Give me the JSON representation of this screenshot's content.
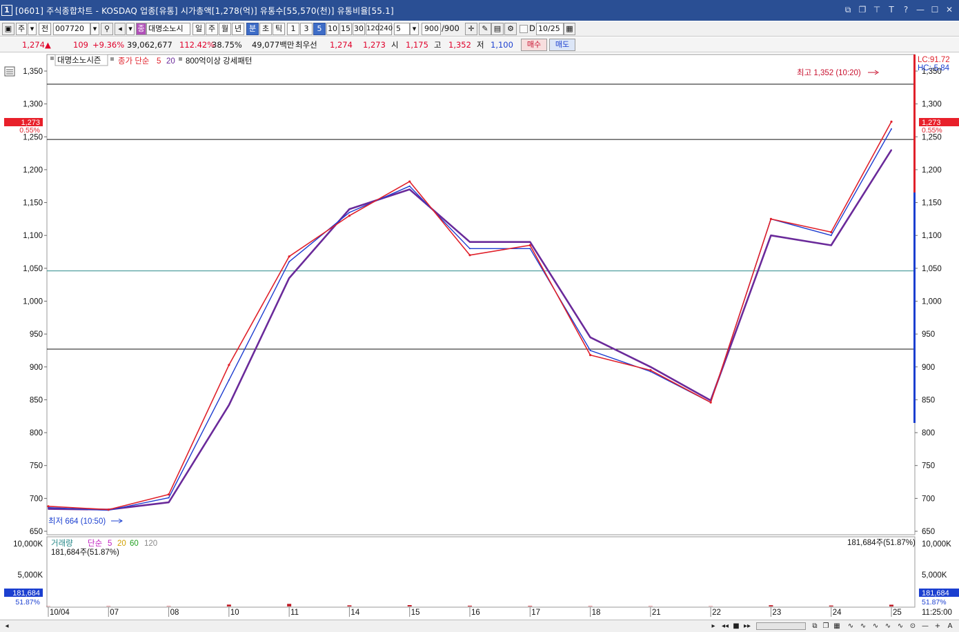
{
  "window": {
    "number": "1",
    "title": "[0601] 주식종합차트 - KOSDAQ 업종[유통] 시가총액[1,278(억)] 유통수[55,570(천)] 유통비율[55.1]",
    "controls": [
      "link-icon",
      "restore-icon",
      "pin-icon",
      "font-icon",
      "help-icon",
      "minimize-icon",
      "maximize-icon",
      "close-icon"
    ]
  },
  "toolbar": {
    "code_type": "주",
    "prev_label": "전",
    "code": "007720",
    "stock_badge": "종",
    "stock_name": "대명소노시",
    "period_tabs": [
      "일",
      "주",
      "월",
      "년",
      "분",
      "초",
      "틱"
    ],
    "active_period": "분",
    "minute_values": [
      "1",
      "3",
      "5",
      "10",
      "15",
      "30",
      "120",
      "240"
    ],
    "active_minute": "5",
    "interval_input": "5",
    "count_display": "900",
    "count_total": "/900",
    "date_check": "D",
    "date_value": "10/25"
  },
  "quote": {
    "price": "1,274",
    "arrow": "▲",
    "change": "109",
    "change_pct": "+9.36%",
    "volume": "39,062,677",
    "vol_ratio": "112.42%",
    "turnover": "38.75%",
    "amount": "49,077백만",
    "best_label": "최우선",
    "ask": "1,274",
    "bid": "1,273",
    "open_label": "시",
    "open": "1,175",
    "high_label": "고",
    "high": "1,352",
    "low_label": "저",
    "low": "1,100",
    "buy_label": "매수",
    "sell_label": "매도"
  },
  "chart": {
    "legend_name": "대명소노시즌",
    "legend_ma": "종가 단순",
    "legend_ma5": "5",
    "legend_ma20": "20",
    "legend_pattern": "800억이상 강세패턴",
    "lc_label": "LC:91.72",
    "hc_label": "HC:-5.84",
    "price_labels": [
      "1,350",
      "1,300",
      "1,250",
      "1,200",
      "1,150",
      "1,100",
      "1,050",
      "1,000",
      "950",
      "900",
      "850",
      "800",
      "750",
      "700",
      "650"
    ],
    "current_price_tag": "1,273",
    "current_pct_tag": "0.55%",
    "high_annotation": "최고 1,352 (10:20)",
    "low_annotation": "최저 664 (10:50)",
    "volume_legend_name": "거래량",
    "volume_legend_ma": "단순",
    "volume_legend_ma5": "5",
    "volume_legend_ma20": "20",
    "volume_legend_ma60": "60",
    "volume_legend_ma120": "120",
    "volume_current_label": "181,684주(51.87%)",
    "volume_axis_labels": [
      "10,000K",
      "5,000K"
    ],
    "volume_tag": "181,684",
    "volume_pct_tag": "51.87%",
    "x_labels": [
      "10/04",
      "07",
      "08",
      "10",
      "11",
      "14",
      "15",
      "16",
      "17",
      "18",
      "21",
      "22",
      "23",
      "24",
      "25"
    ],
    "time_label": "11:25:00",
    "colors": {
      "price": "#e0202a",
      "ma5": "#1c3bd0",
      "ma20": "#6a2a9a",
      "grid": "#111111",
      "teal": "#2a8a8a"
    }
  },
  "chart_data": {
    "type": "line",
    "title": "",
    "x": [
      "10/04",
      "07",
      "08",
      "10",
      "11",
      "14",
      "15",
      "16",
      "17",
      "18",
      "21",
      "22",
      "23",
      "24",
      "25"
    ],
    "y_range": [
      650,
      1360
    ],
    "series": [
      {
        "name": "종가",
        "values": [
          688,
          683,
          706,
          903,
          1068,
          1130,
          1182,
          1070,
          1085,
          918,
          895,
          846,
          1125,
          1105,
          1273
        ]
      },
      {
        "name": "5",
        "values": [
          686,
          682,
          701,
          880,
          1060,
          1135,
          1175,
          1080,
          1080,
          925,
          893,
          846,
          1125,
          1100,
          1262
        ]
      },
      {
        "name": "20",
        "values": [
          684,
          683,
          694,
          842,
          1035,
          1140,
          1170,
          1090,
          1090,
          945,
          900,
          849,
          1100,
          1085,
          1230
        ]
      }
    ],
    "reference_lines": [
      1330,
      1246,
      1046,
      927
    ],
    "volume": {
      "name": "거래량",
      "values": [
        35,
        50,
        55,
        300,
        420,
        180,
        220,
        120,
        90,
        60,
        50,
        40,
        200,
        150,
        280
      ],
      "unit": "K"
    }
  }
}
